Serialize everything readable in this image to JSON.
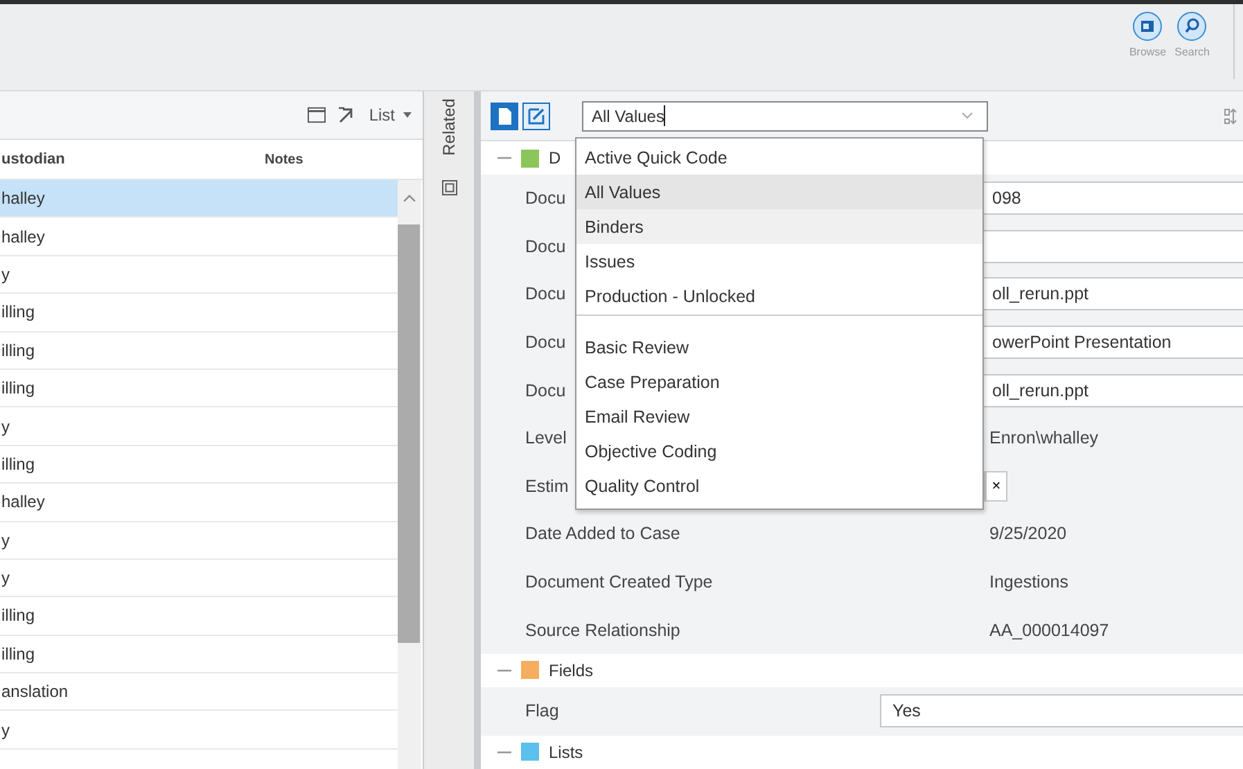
{
  "toolbar": {
    "buttons": [
      {
        "kind": "browse",
        "label": "Browse"
      },
      {
        "kind": "search",
        "label": "Search"
      }
    ]
  },
  "list_panel": {
    "view_menu": {
      "label": "List"
    },
    "columns": [
      "ustodian",
      "Notes"
    ],
    "rows": [
      {
        "column_1": "halley",
        "selected": true
      },
      {
        "column_1": "halley",
        "selected": false
      },
      {
        "column_1": "y",
        "selected": false
      },
      {
        "column_1": "illing",
        "selected": false
      },
      {
        "column_1": "illing",
        "selected": false
      },
      {
        "column_1": "illing",
        "selected": false
      },
      {
        "column_1": "y",
        "selected": false
      },
      {
        "column_1": "illing",
        "selected": false
      },
      {
        "column_1": "halley",
        "selected": false
      },
      {
        "column_1": "y",
        "selected": false
      },
      {
        "column_1": "y",
        "selected": false
      },
      {
        "column_1": "illing",
        "selected": false
      },
      {
        "column_1": "illing",
        "selected": false
      },
      {
        "column_1": "anslation",
        "selected": false
      },
      {
        "column_1": "y",
        "selected": false
      }
    ]
  },
  "side_tab": {
    "label": "Related"
  },
  "coding_panel": {
    "layout_select": {
      "value": "All Values",
      "expanded": true,
      "option_groups": [
        [
          {
            "label": "Active Quick Code",
            "selected": false,
            "highlighted": false
          },
          {
            "label": "All Values",
            "selected": true,
            "highlighted": false
          },
          {
            "label": "Binders",
            "selected": false,
            "highlighted": true
          },
          {
            "label": "Issues",
            "selected": false,
            "highlighted": false
          },
          {
            "label": "Production - Unlocked",
            "selected": false,
            "highlighted": false
          }
        ],
        [
          {
            "label": "Basic Review",
            "selected": false,
            "highlighted": false
          },
          {
            "label": "Case Preparation",
            "selected": false,
            "highlighted": false
          },
          {
            "label": "Email Review",
            "selected": false,
            "highlighted": false
          },
          {
            "label": "Objective Coding",
            "selected": false,
            "highlighted": false
          },
          {
            "label": "Quality Control",
            "selected": false,
            "highlighted": false
          }
        ]
      ]
    },
    "sections": [
      {
        "title": "D",
        "color": "#8cc65a",
        "expanded": true,
        "fields": [
          {
            "label": "Docu",
            "kind": "input",
            "value": "098"
          },
          {
            "label": "Docu",
            "kind": "input"
          },
          {
            "label": "Docu",
            "kind": "input",
            "value": "oll_rerun.ppt"
          },
          {
            "label": "Docu",
            "kind": "input",
            "value": "owerPoint Presentation"
          },
          {
            "label": "Docu",
            "kind": "input",
            "value": "oll_rerun.ppt"
          },
          {
            "label": "Level",
            "kind": "text",
            "value": "Enron\\whalley"
          },
          {
            "label": "Estim",
            "kind": "clearable",
            "clear_label": "×"
          },
          {
            "label": "Date Added to Case",
            "kind": "text",
            "value": "9/25/2020"
          },
          {
            "label": "Document Created Type",
            "kind": "text",
            "value": "Ingestions"
          },
          {
            "label": "Source Relationship",
            "kind": "text",
            "value": "AA_000014097"
          }
        ]
      },
      {
        "title": "Fields",
        "color": "#f5ad5f",
        "expanded": true,
        "fields": [
          {
            "label": "Flag",
            "kind": "input",
            "value": "Yes"
          }
        ]
      },
      {
        "title": "Lists",
        "color": "#5bc0eb",
        "expanded": true
      }
    ]
  }
}
